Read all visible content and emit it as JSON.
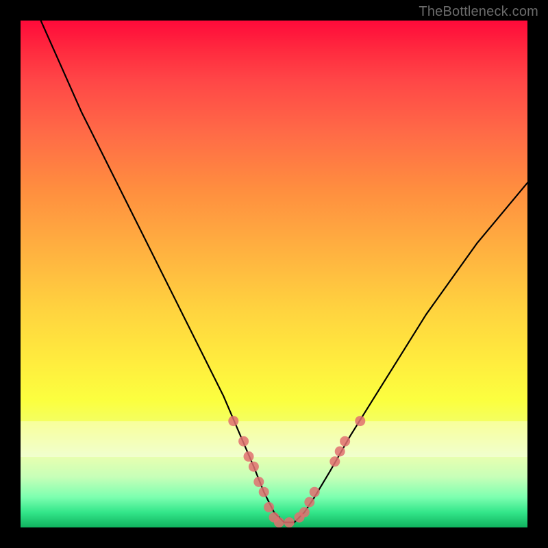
{
  "watermark": "TheBottleneck.com",
  "chart_data": {
    "type": "line",
    "title": "",
    "xlabel": "",
    "ylabel": "",
    "xlim": [
      0,
      100
    ],
    "ylim": [
      0,
      100
    ],
    "grid": false,
    "legend": false,
    "series": [
      {
        "name": "bottleneck-curve",
        "x": [
          4,
          8,
          12,
          16,
          20,
          24,
          28,
          32,
          36,
          40,
          43,
          46,
          48,
          50,
          52,
          54,
          56,
          58,
          61,
          65,
          70,
          75,
          80,
          85,
          90,
          95,
          100
        ],
        "values": [
          100,
          91,
          82,
          74,
          66,
          58,
          50,
          42,
          34,
          26,
          19,
          12,
          7,
          3,
          1,
          1,
          3,
          6,
          11,
          18,
          26,
          34,
          42,
          49,
          56,
          62,
          68
        ]
      }
    ],
    "markers": {
      "name": "highlighted-points",
      "color": "#e07070",
      "points": [
        {
          "x": 42,
          "y": 21
        },
        {
          "x": 44,
          "y": 17
        },
        {
          "x": 45,
          "y": 14
        },
        {
          "x": 46,
          "y": 12
        },
        {
          "x": 47,
          "y": 9
        },
        {
          "x": 48,
          "y": 7
        },
        {
          "x": 49,
          "y": 4
        },
        {
          "x": 50,
          "y": 2
        },
        {
          "x": 51,
          "y": 1
        },
        {
          "x": 53,
          "y": 1
        },
        {
          "x": 55,
          "y": 2
        },
        {
          "x": 56,
          "y": 3
        },
        {
          "x": 57,
          "y": 5
        },
        {
          "x": 58,
          "y": 7
        },
        {
          "x": 62,
          "y": 13
        },
        {
          "x": 63,
          "y": 15
        },
        {
          "x": 64,
          "y": 17
        },
        {
          "x": 67,
          "y": 21
        }
      ]
    },
    "band": {
      "y_from": 14,
      "y_to": 21,
      "opacity": 0.38
    }
  },
  "colors": {
    "curve": "#000000",
    "marker": "#e07070",
    "frame": "#000000"
  }
}
